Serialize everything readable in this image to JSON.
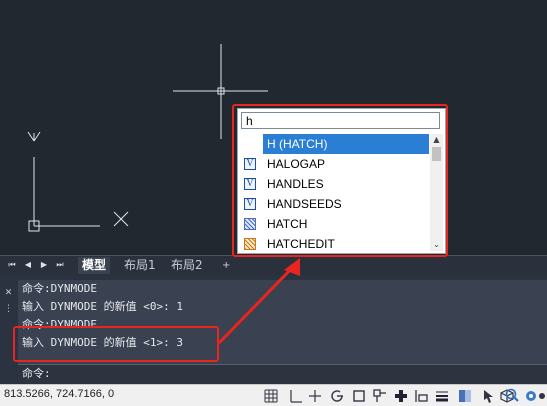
{
  "canvas": {
    "ucs_y_label": "Y",
    "ucs_x_label": "X",
    "background_color": "#212830"
  },
  "autocomplete": {
    "input_value": "h",
    "items": [
      {
        "label": "H (HATCH)",
        "icon": "blank",
        "selected": true
      },
      {
        "label": "HALOGAP",
        "icon": "system-variable-icon"
      },
      {
        "label": "HANDLES",
        "icon": "system-variable-icon"
      },
      {
        "label": "HANDSEEDS",
        "icon": "system-variable-icon"
      },
      {
        "label": "HATCH",
        "icon": "hatch-icon"
      },
      {
        "label": "HATCHEDIT",
        "icon": "hatchedit-icon"
      }
    ],
    "variable_icon_glyph": "V",
    "scroll_up_glyph": "▲",
    "scroll_down_glyph": "⌄"
  },
  "tabs": {
    "items": [
      {
        "label": "模型",
        "active": true
      },
      {
        "label": "布局1"
      },
      {
        "label": "布局2"
      },
      {
        "label": "+"
      }
    ],
    "nav": [
      "⏮",
      "◀",
      "▶",
      "⏭"
    ]
  },
  "command": {
    "history": [
      "命令:DYNMODE",
      "输入 DYNMODE 的新值 <0>: 1",
      "命令:DYNMODE",
      "输入 DYNMODE 的新值 <1>: 3"
    ],
    "prompt": "命令:",
    "close_glyph": "✕",
    "options_glyph": "⋮"
  },
  "status_bar": {
    "coordinates": "813.5266, 724.7166, 0",
    "icons": [
      "grid-icon",
      "snap-icon",
      "ortho-icon",
      "polar-icon",
      "osnap-icon",
      "otrack-icon",
      "ducs-icon",
      "dyn-icon",
      "lineweight-icon",
      "transparency-icon",
      "selection-cycling-icon",
      "3d-osnap-icon",
      "annotation-icon",
      "isolate-icon",
      "settings-icon"
    ]
  },
  "highlight_color": "#e8251f",
  "selection_color": "#2a7fd4"
}
